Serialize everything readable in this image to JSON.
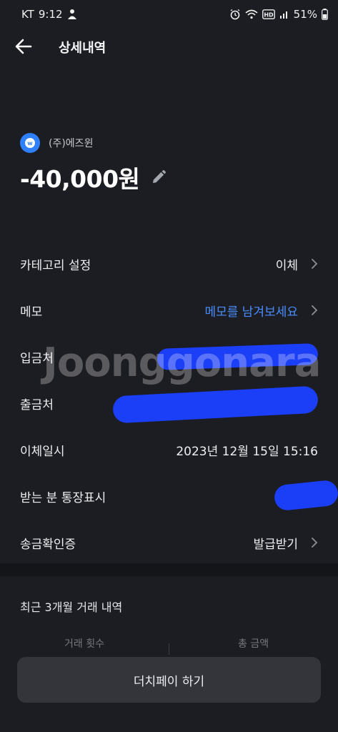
{
  "status_bar": {
    "carrier": "KT",
    "time": "9:12",
    "battery_percent": "51%",
    "hd_badge": "HD",
    "icons": [
      "notification-person-icon",
      "alarm-icon",
      "wifi-icon",
      "hd-voice-icon",
      "signal-icon",
      "battery-icon"
    ]
  },
  "header": {
    "title": "상세내역"
  },
  "merchant": {
    "name": "(주)에즈윈",
    "logo_letter": "w",
    "logo_color": "#2f80ff"
  },
  "amount": "-40,000원",
  "details": {
    "category": {
      "label": "카테고리 설정",
      "value": "이체"
    },
    "memo": {
      "label": "메모",
      "value": "메모를 남겨보세요"
    },
    "deposit_to": {
      "label": "입금처",
      "value": ""
    },
    "withdraw_from": {
      "label": "출금처",
      "value": ""
    },
    "transfer_time": {
      "label": "이체일시",
      "value": "2023년 12월 15일 15:16"
    },
    "recipient_statement": {
      "label": "받는 분 통장표시",
      "value": ""
    },
    "certificate": {
      "label": "송금확인증",
      "value": "발급받기"
    }
  },
  "watermark": "Joonggonara",
  "recent": {
    "title": "최근 3개월 거래 내역",
    "col_count": "거래 횟수",
    "col_total": "총 금액"
  },
  "bottom_button": "더치페이 하기",
  "colors": {
    "background": "#1c1d22",
    "accent": "#4a8dff",
    "redaction": "#1b3ef7",
    "button_bg": "#33353b"
  }
}
